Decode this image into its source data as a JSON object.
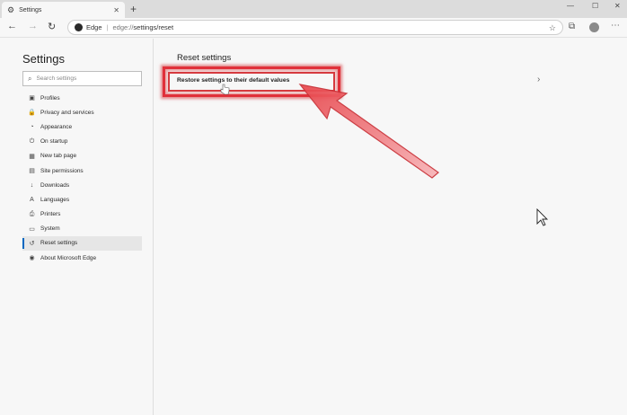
{
  "browser": {
    "tab_title": "Settings",
    "tab_close": "✕",
    "new_tab": "+",
    "window_controls": [
      "—",
      "☐",
      "✕"
    ],
    "nav": {
      "back": "←",
      "forward": "→",
      "refresh": "↻"
    },
    "address": {
      "site": "Edge",
      "url_prefix": "edge://",
      "url_path": "settings/reset"
    }
  },
  "sidebar": {
    "title": "Settings",
    "search_placeholder": "Search settings",
    "items": [
      {
        "label": "Profiles",
        "icon": "person-icon",
        "glyph": "▣"
      },
      {
        "label": "Privacy and services",
        "icon": "lock-icon",
        "glyph": "🔒"
      },
      {
        "label": "Appearance",
        "icon": "palette-icon",
        "glyph": "◔"
      },
      {
        "label": "On startup",
        "icon": "power-icon",
        "glyph": "⏻"
      },
      {
        "label": "New tab page",
        "icon": "grid-icon",
        "glyph": "▦"
      },
      {
        "label": "Site permissions",
        "icon": "site-permissions-icon",
        "glyph": "▤"
      },
      {
        "label": "Downloads",
        "icon": "download-icon",
        "glyph": "↓"
      },
      {
        "label": "Languages",
        "icon": "language-icon",
        "glyph": "A"
      },
      {
        "label": "Printers",
        "icon": "printer-icon",
        "glyph": "⎙"
      },
      {
        "label": "System",
        "icon": "laptop-icon",
        "glyph": "▭"
      },
      {
        "label": "Reset settings",
        "icon": "reset-icon",
        "glyph": "↺",
        "active": true
      },
      {
        "label": "About Microsoft Edge",
        "icon": "edge-icon",
        "glyph": "◉"
      }
    ]
  },
  "main": {
    "title": "Reset settings",
    "restore_label": "Restore settings to their default values"
  },
  "colors": {
    "accent": "#0067c0",
    "highlight": "#e0303a",
    "arrow": "#e8454b"
  }
}
